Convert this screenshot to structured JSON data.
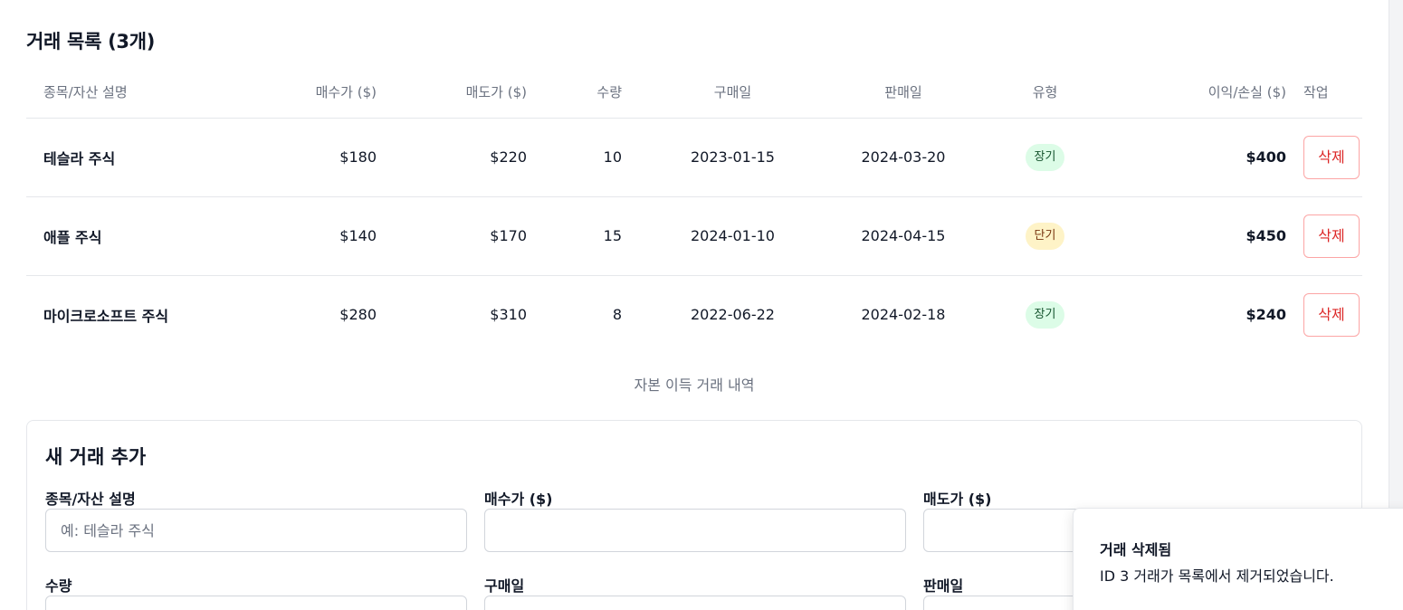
{
  "trades_section": {
    "title": "거래 목록 (3개)",
    "columns": {
      "description": "종목/자산 설명",
      "buy_price": "매수가 ($)",
      "sell_price": "매도가 ($)",
      "quantity": "수량",
      "buy_date": "구매일",
      "sell_date": "판매일",
      "type": "유형",
      "profit_loss": "이익/손실 ($)",
      "actions": "작업"
    },
    "rows": [
      {
        "description": "테슬라 주식",
        "buy_price": "$180",
        "sell_price": "$220",
        "quantity": "10",
        "buy_date": "2023-01-15",
        "sell_date": "2024-03-20",
        "type": "장기",
        "type_kind": "long",
        "profit_loss": "$400",
        "action": "삭제"
      },
      {
        "description": "애플 주식",
        "buy_price": "$140",
        "sell_price": "$170",
        "quantity": "15",
        "buy_date": "2024-01-10",
        "sell_date": "2024-04-15",
        "type": "단기",
        "type_kind": "short",
        "profit_loss": "$450",
        "action": "삭제"
      },
      {
        "description": "마이크로소프트 주식",
        "buy_price": "$280",
        "sell_price": "$310",
        "quantity": "8",
        "buy_date": "2022-06-22",
        "sell_date": "2024-02-18",
        "type": "장기",
        "type_kind": "long",
        "profit_loss": "$240",
        "action": "삭제"
      }
    ],
    "caption": "자본 이득 거래 내역"
  },
  "add_form": {
    "title": "새 거래 추가",
    "description_label": "종목/자산 설명",
    "description_placeholder": "예: 테슬라 주식",
    "buy_price_label": "매수가 ($)",
    "sell_price_label": "매도가 ($)",
    "quantity_label": "수량",
    "buy_date_label": "구매일",
    "sell_date_label": "판매일"
  },
  "toast": {
    "title": "거래 삭제됨",
    "description": "ID 3 거래가 목록에서 제거되었습니다."
  },
  "colors": {
    "profit": "#16a34a",
    "delete": "#dc2626",
    "badge_long_bg": "#dcfce7",
    "badge_short_bg": "#fef3c7"
  }
}
